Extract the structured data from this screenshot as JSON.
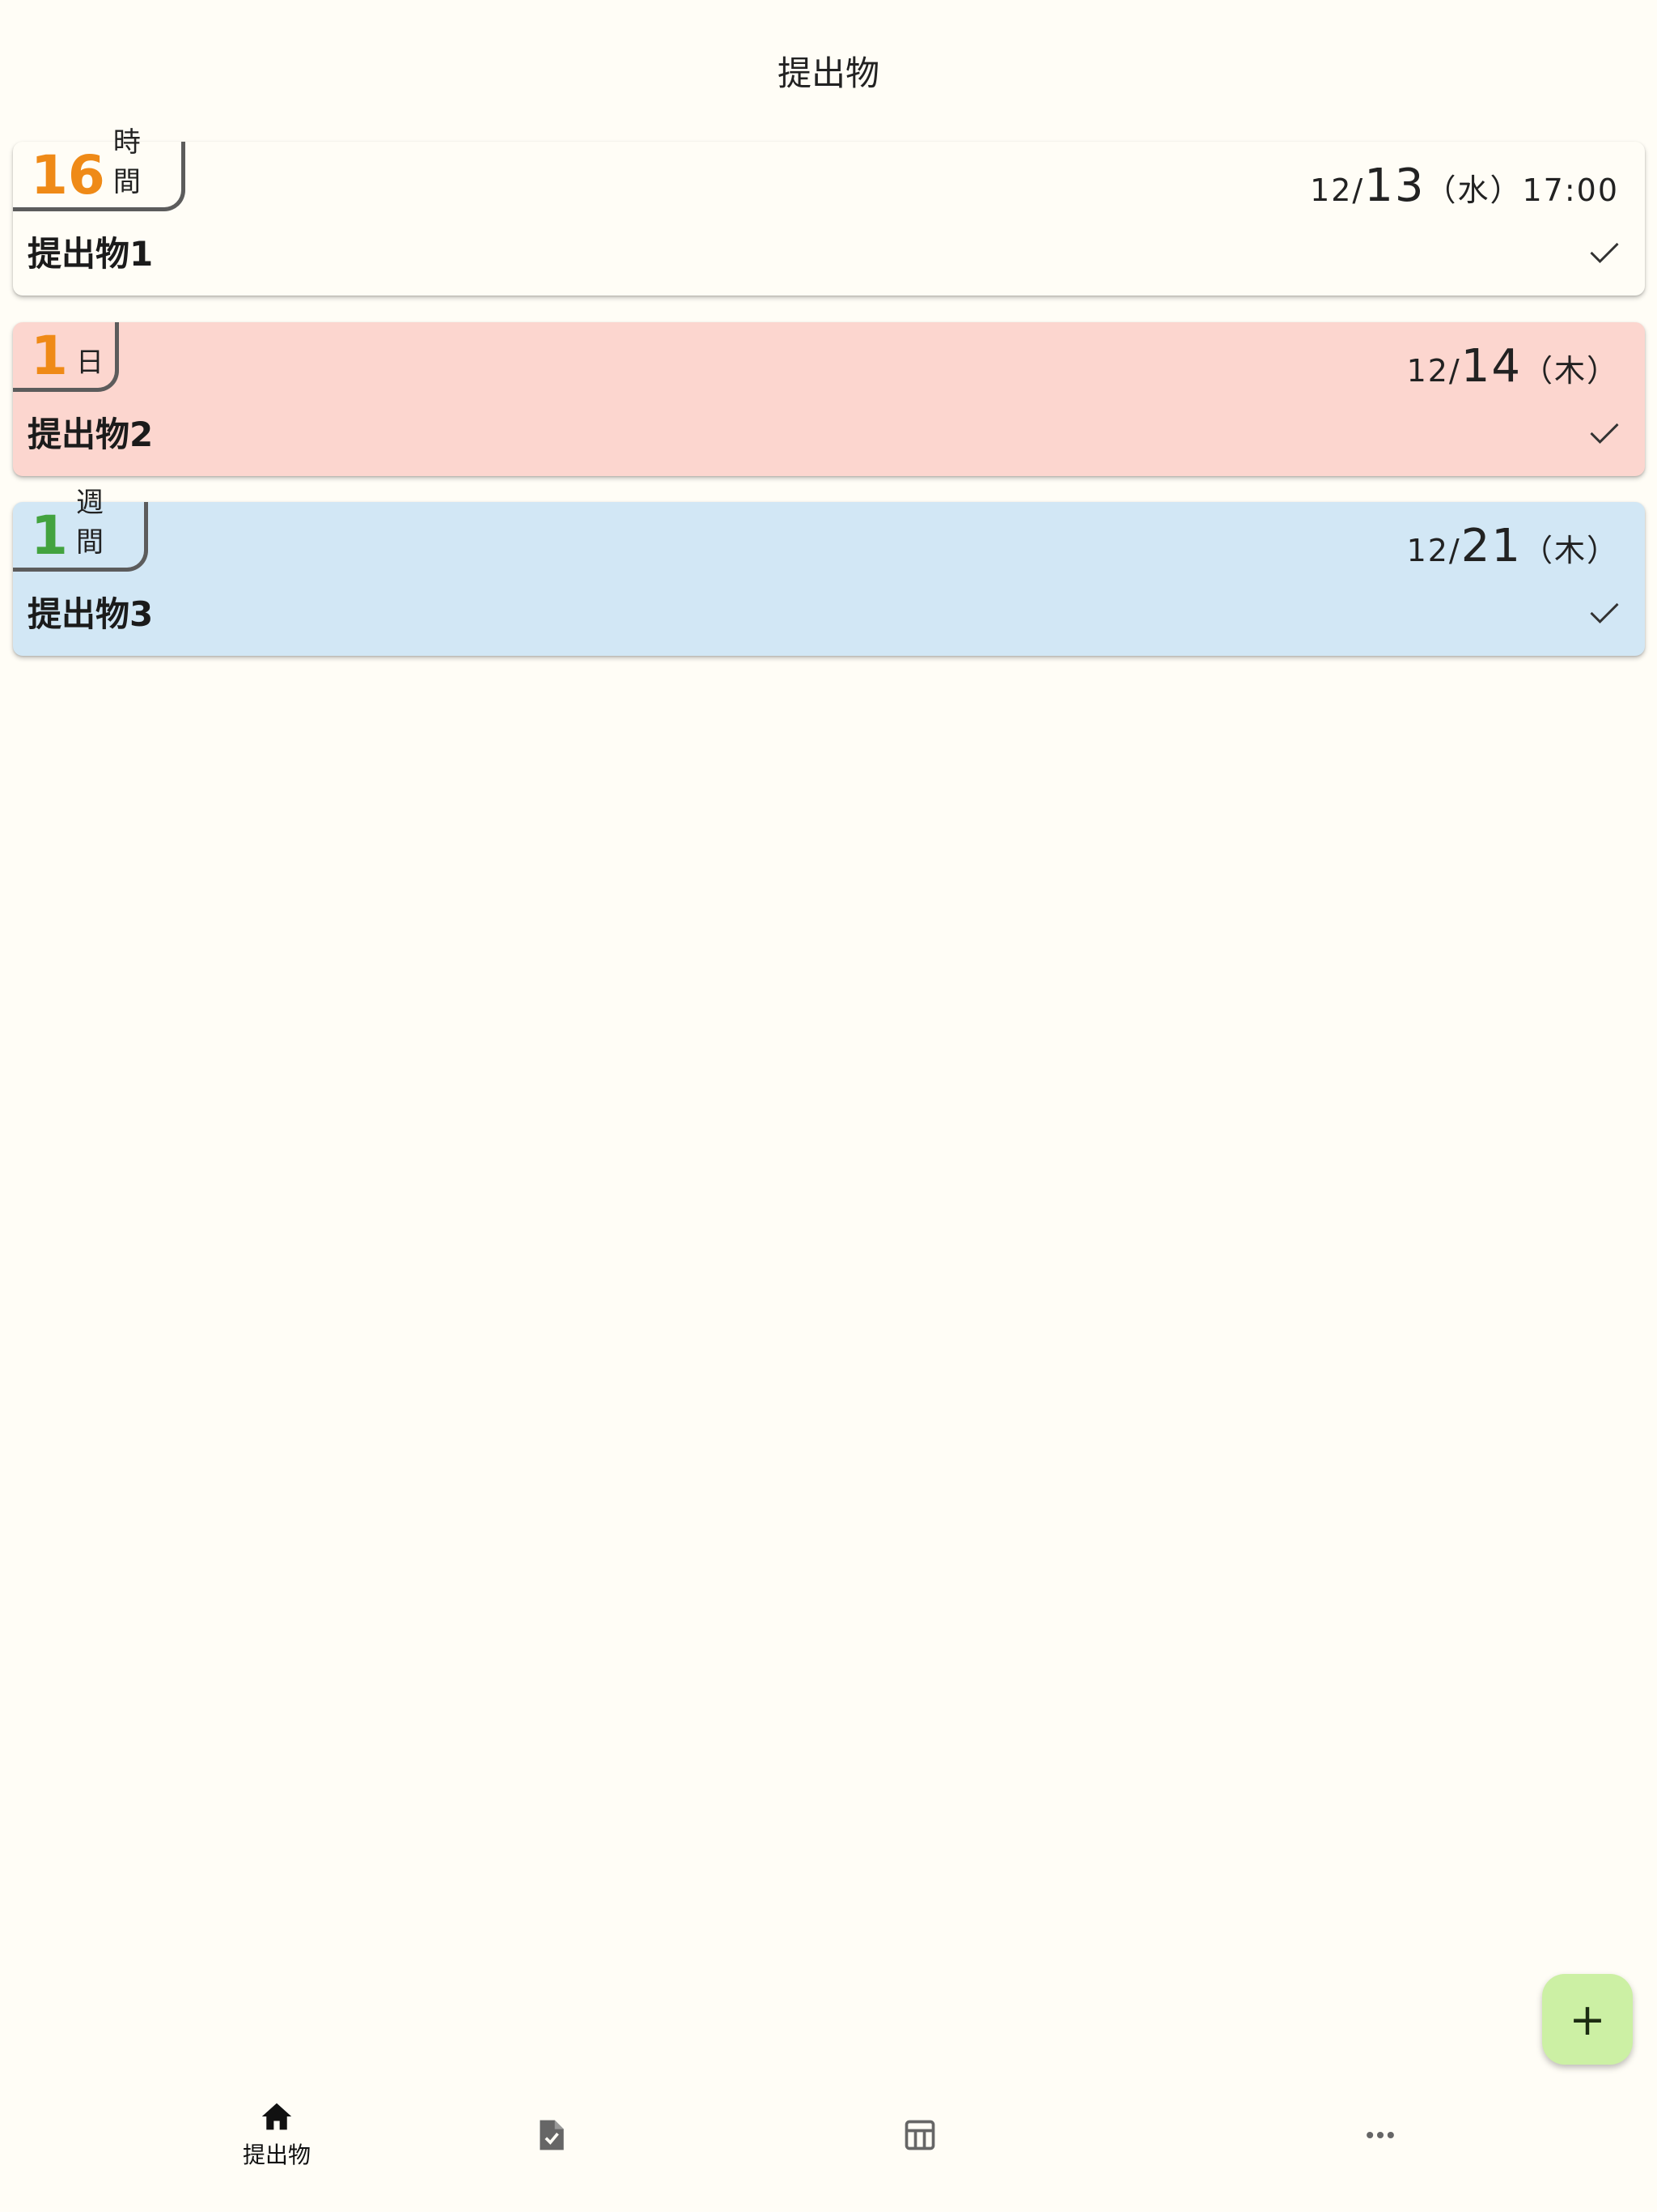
{
  "app": {
    "title": "提出物"
  },
  "assignments": [
    {
      "remaining_value": "16",
      "remaining_unit": "時間",
      "due_prefix": "12/",
      "due_day": "13",
      "due_suffix": "（水）17:00",
      "title": "提出物1",
      "card_color": "#fffdf6",
      "accent_color": "#ef8a17"
    },
    {
      "remaining_value": "1",
      "remaining_unit": "日",
      "due_prefix": "12/",
      "due_day": "14",
      "due_suffix": "（木）",
      "title": "提出物2",
      "card_color": "#fcd6cf",
      "accent_color": "#ef8a17"
    },
    {
      "remaining_value": "1",
      "remaining_unit": "週間",
      "due_prefix": "12/",
      "due_day": "21",
      "due_suffix": "（木）",
      "title": "提出物3",
      "card_color": "#d2e7f5",
      "accent_color": "#43a33f"
    }
  ],
  "fab": {
    "icon": "plus-icon",
    "label": "+"
  },
  "bottom_nav": [
    {
      "icon": "home-icon",
      "label": "提出物",
      "active": true
    },
    {
      "icon": "document-check-icon",
      "label": "",
      "active": false
    },
    {
      "icon": "table-icon",
      "label": "",
      "active": false
    },
    {
      "icon": "more-horizontal-icon",
      "label": "",
      "active": false
    }
  ]
}
